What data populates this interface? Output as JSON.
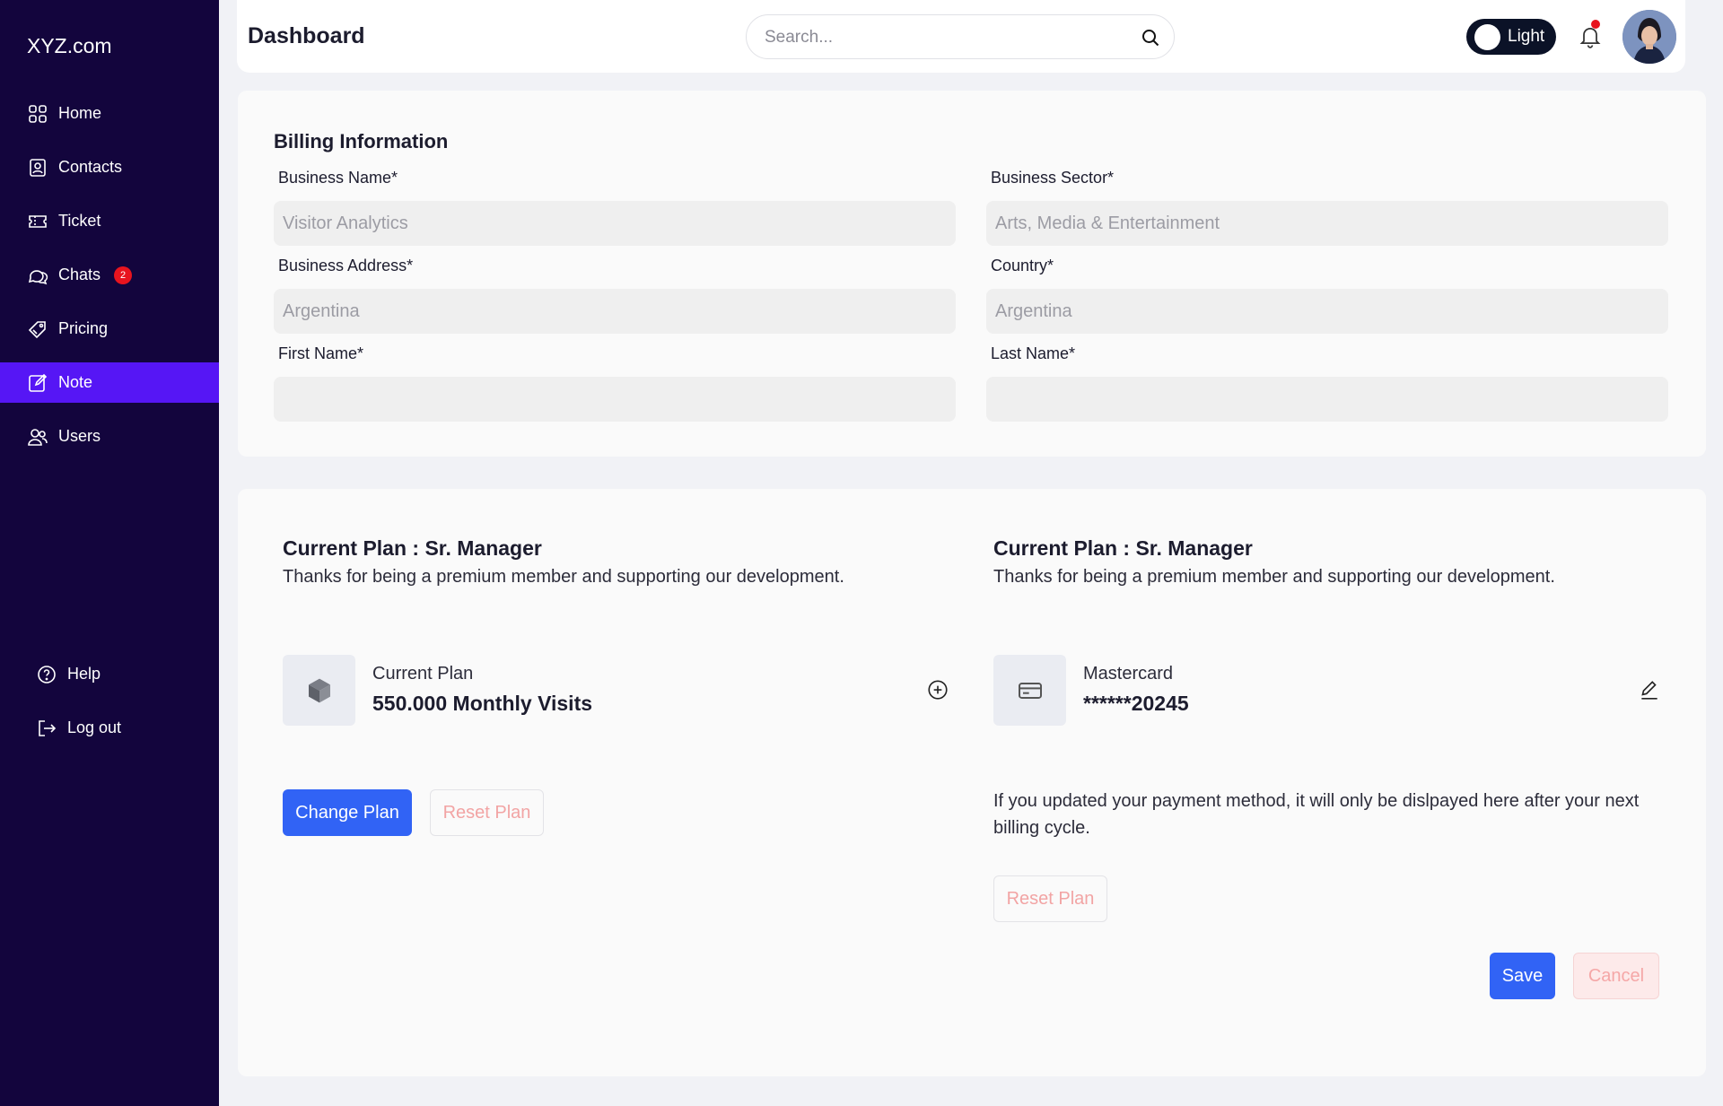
{
  "sidebar": {
    "brand": "XYZ.com",
    "items": [
      {
        "label": "Home",
        "icon": "grid-icon"
      },
      {
        "label": "Contacts",
        "icon": "contacts-icon"
      },
      {
        "label": "Ticket",
        "icon": "ticket-icon"
      },
      {
        "label": "Chats",
        "icon": "chat-icon",
        "badge": "2"
      },
      {
        "label": "Pricing",
        "icon": "tag-icon"
      },
      {
        "label": "Note",
        "icon": "note-icon",
        "active": true
      },
      {
        "label": "Users",
        "icon": "users-icon"
      }
    ],
    "bottom_items": [
      {
        "label": "Help",
        "icon": "help-icon"
      },
      {
        "label": "Log out",
        "icon": "logout-icon"
      }
    ],
    "active_color": "#5616f5",
    "background": "#13053d"
  },
  "header": {
    "title": "Dashboard",
    "search_placeholder": "Search...",
    "theme_toggle_label": "Light"
  },
  "billing": {
    "title": "Billing Information",
    "fields": {
      "business_name": {
        "label": "Business Name*",
        "placeholder": "Visitor Analytics"
      },
      "business_sector": {
        "label": "Business Sector*",
        "placeholder": "Arts, Media & Entertainment"
      },
      "business_address": {
        "label": "Business Address*",
        "placeholder": "Argentina"
      },
      "country": {
        "label": "Country*",
        "placeholder": "Argentina"
      },
      "first_name": {
        "label": "First Name*",
        "placeholder": ""
      },
      "last_name": {
        "label": "Last Name*",
        "placeholder": ""
      }
    }
  },
  "plan_left": {
    "title": "Current Plan : Sr. Manager",
    "subtitle": "Thanks for being a premium member and supporting our development.",
    "tile_label": "Current Plan",
    "tile_value": "550.000 Monthly Visits",
    "change_button": "Change Plan",
    "reset_button": "Reset Plan"
  },
  "plan_right": {
    "title": "Current Plan : Sr. Manager",
    "subtitle": "Thanks for being a premium member and supporting our development.",
    "tile_label": "Mastercard",
    "tile_value": "******20245",
    "note": "If you updated your payment method, it will only be dislpayed here after your next billing cycle.",
    "reset_button": "Reset Plan"
  },
  "actions": {
    "save": "Save",
    "cancel": "Cancel"
  },
  "colors": {
    "primary_button": "#3163f5",
    "badge": "#e8141e"
  }
}
